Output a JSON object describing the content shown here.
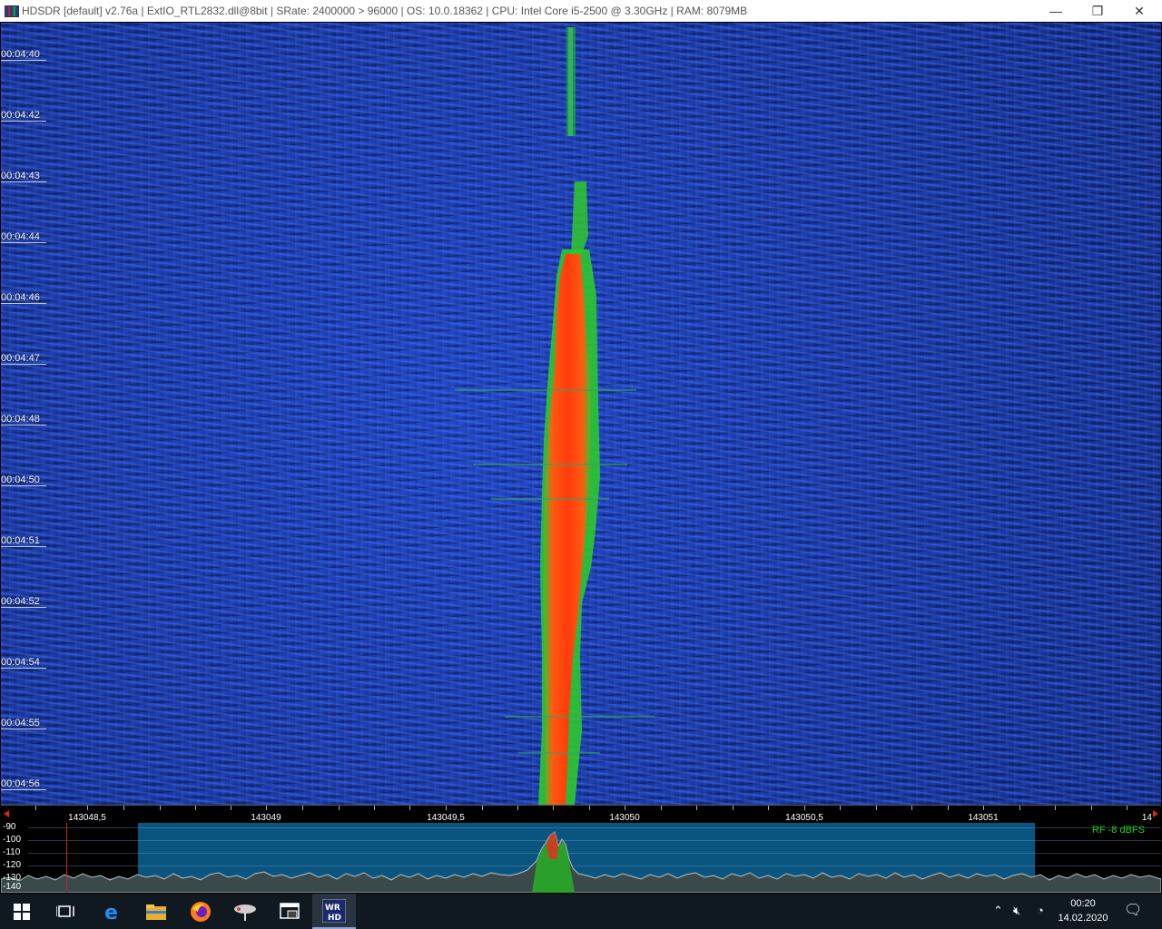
{
  "window": {
    "title": "HDSDR  [default]  v2.76a  |  ExtIO_RTL2832.dll@8bit  |  SRate: 2400000 > 96000  |  OS: 10.0.18362   |  CPU: Intel Core i5-2500 @ 3.30GHz  |  RAM: 8079MB",
    "minimize_symbol": "—",
    "maximize_symbol": "❐",
    "close_symbol": "✕"
  },
  "waterfall": {
    "timestamps": [
      "00:04:40",
      "00:04:42",
      "00:04:43",
      "00:04:44",
      "00:04:46",
      "00:04:47",
      "00:04:48",
      "00:04:50",
      "00:04:51",
      "00:04:52",
      "00:04:54",
      "00:04:55",
      "00:04:56"
    ]
  },
  "frequency_scale": {
    "labels": [
      "143048,5",
      "143049",
      "143049,5",
      "143050",
      "143050,5",
      "143051"
    ],
    "right_label": "14"
  },
  "spectrum": {
    "db_labels": [
      "-90",
      "-100",
      "-110",
      "-120",
      "-130",
      "-140"
    ],
    "rf_level": "RF  -8 dBFS"
  },
  "taskbar": {
    "time": "00:20",
    "date": "14.02.2020",
    "apps": [
      "start-icon",
      "task-view-icon",
      "edge-icon",
      "file-explorer-icon",
      "firefox-icon",
      "satellite-app-icon",
      "window-app-icon",
      "hdsdr-icon"
    ]
  },
  "colors": {
    "waterfall_background": "#1a3aa0",
    "signal_core": "#ff4a10",
    "signal_edge": "#2ec82e",
    "spectrum_passband": "#0a5580"
  }
}
